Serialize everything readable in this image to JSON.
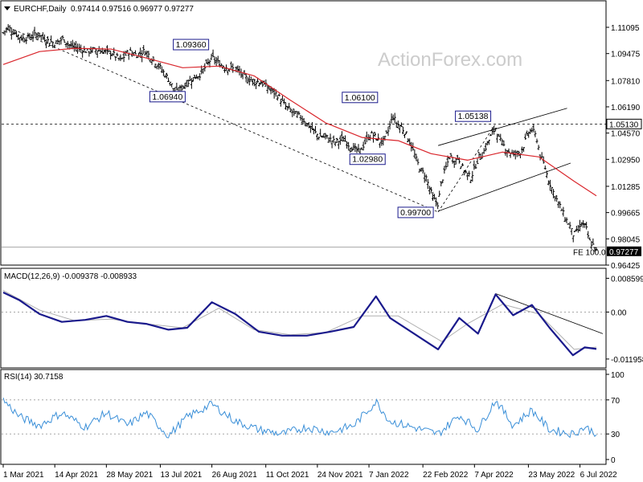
{
  "header": {
    "symbol_icon": "triangle-down-icon",
    "symbol": "EURCHF,Daily",
    "ohlc": "0.97414 0.97516 0.96977 0.97277"
  },
  "watermark": "ActionForex.com",
  "chart_data": [
    {
      "type": "line",
      "panel": "price",
      "yticks": [
        "1.11095",
        "1.09475",
        "1.07810",
        "1.06190",
        "1.04570",
        "1.02950",
        "1.01285",
        "0.99665",
        "0.98045",
        "0.96425"
      ],
      "ylim": [
        0.96425,
        1.11095
      ],
      "price_tag": "0.97277",
      "level_tag": "1.05130",
      "level_value": 1.0513,
      "fe_label": "FE 100.0",
      "fe_value": 0.9753,
      "annotations": [
        {
          "text": "1.09360",
          "x": "26 Aug 2021",
          "y": 1.0936
        },
        {
          "text": "1.06940",
          "x": "26 Jul 2021",
          "y": 1.0694
        },
        {
          "text": "1.06100",
          "x": "13 Jan 2022",
          "y": 1.061
        },
        {
          "text": "1.02980",
          "x": "3 Jan 2022",
          "y": 1.0298
        },
        {
          "text": "0.99700",
          "x": "7 Mar 2022",
          "y": 0.997
        },
        {
          "text": "1.05138",
          "x": "25 Apr 2022",
          "y": 1.05138
        }
      ],
      "close_series": [
        [
          "1 Mar 2021",
          1.1075
        ],
        [
          "5 Mar 2021",
          1.111
        ],
        [
          "10 Mar 2021",
          1.108
        ],
        [
          "17 Mar 2021",
          1.104
        ],
        [
          "24 Mar 2021",
          1.105
        ],
        [
          "31 Mar 2021",
          1.107
        ],
        [
          "7 Apr 2021",
          1.103
        ],
        [
          "14 Apr 2021",
          1.101
        ],
        [
          "21 Apr 2021",
          1.104
        ],
        [
          "28 Apr 2021",
          1.099
        ],
        [
          "5 May 2021",
          1.098
        ],
        [
          "12 May 2021",
          1.096
        ],
        [
          "19 May 2021",
          1.097
        ],
        [
          "26 May 2021",
          1.096
        ],
        [
          "2 Jun 2021",
          1.095
        ],
        [
          "9 Jun 2021",
          1.0905
        ],
        [
          "16 Jun 2021",
          1.096
        ],
        [
          "23 Jun 2021",
          1.094
        ],
        [
          "30 Jun 2021",
          1.0965
        ],
        [
          "7 Jul 2021",
          1.091
        ],
        [
          "14 Jul 2021",
          1.085
        ],
        [
          "21 Jul 2021",
          1.078
        ],
        [
          "26 Jul 2021",
          1.0705
        ],
        [
          "2 Aug 2021",
          1.075
        ],
        [
          "9 Aug 2021",
          1.079
        ],
        [
          "16 Aug 2021",
          1.082
        ],
        [
          "23 Aug 2021",
          1.089
        ],
        [
          "26 Aug 2021",
          1.0925
        ],
        [
          "2 Sep 2021",
          1.088
        ],
        [
          "9 Sep 2021",
          1.086
        ],
        [
          "16 Sep 2021",
          1.085
        ],
        [
          "23 Sep 2021",
          1.08
        ],
        [
          "30 Sep 2021",
          1.078
        ],
        [
          "7 Oct 2021",
          1.077
        ],
        [
          "14 Oct 2021",
          1.073
        ],
        [
          "21 Oct 2021",
          1.069
        ],
        [
          "28 Oct 2021",
          1.062
        ],
        [
          "4 Nov 2021",
          1.058
        ],
        [
          "11 Nov 2021",
          1.055
        ],
        [
          "18 Nov 2021",
          1.049
        ],
        [
          "25 Nov 2021",
          1.044
        ],
        [
          "2 Dec 2021",
          1.043
        ],
        [
          "9 Dec 2021",
          1.04
        ],
        [
          "16 Dec 2021",
          1.042
        ],
        [
          "23 Dec 2021",
          1.037
        ],
        [
          "30 Dec 2021",
          1.034
        ],
        [
          "6 Jan 2022",
          1.043
        ],
        [
          "10 Jan 2022",
          1.045
        ],
        [
          "17 Jan 2022",
          1.04
        ],
        [
          "20 Jan 2022",
          1.041
        ],
        [
          "24 Jan 2022",
          1.048
        ],
        [
          "27 Jan 2022",
          1.057
        ],
        [
          "31 Jan 2022",
          1.051
        ],
        [
          "3 Feb 2022",
          1.05
        ],
        [
          "7 Feb 2022",
          1.046
        ],
        [
          "10 Feb 2022",
          1.042
        ],
        [
          "14 Feb 2022",
          1.034
        ],
        [
          "17 Feb 2022",
          1.028
        ],
        [
          "21 Feb 2022",
          1.022
        ],
        [
          "24 Feb 2022",
          1.02
        ],
        [
          "28 Feb 2022",
          1.011
        ],
        [
          "3 Mar 2022",
          1.005
        ],
        [
          "7 Mar 2022",
          1.002
        ],
        [
          "10 Mar 2022",
          1.016
        ],
        [
          "14 Mar 2022",
          1.025
        ],
        [
          "17 Mar 2022",
          1.032
        ],
        [
          "21 Mar 2022",
          1.028
        ],
        [
          "24 Mar 2022",
          1.031
        ],
        [
          "28 Mar 2022",
          1.024
        ],
        [
          "31 Mar 2022",
          1.021
        ],
        [
          "4 Apr 2022",
          1.018
        ],
        [
          "7 Apr 2022",
          1.024
        ],
        [
          "11 Apr 2022",
          1.031
        ],
        [
          "14 Apr 2022",
          1.033
        ],
        [
          "18 Apr 2022",
          1.039
        ],
        [
          "21 Apr 2022",
          1.044
        ],
        [
          "25 Apr 2022",
          1.049
        ],
        [
          "28 Apr 2022",
          1.042
        ],
        [
          "2 May 2022",
          1.038
        ],
        [
          "5 May 2022",
          1.035
        ],
        [
          "9 May 2022",
          1.033
        ],
        [
          "12 May 2022",
          1.033
        ],
        [
          "16 May 2022",
          1.034
        ],
        [
          "19 May 2022",
          1.038
        ],
        [
          "23 May 2022",
          1.046
        ],
        [
          "26 May 2022",
          1.048
        ],
        [
          "30 May 2022",
          1.043
        ],
        [
          "2 Jun 2022",
          1.032
        ],
        [
          "6 Jun 2022",
          1.025
        ],
        [
          "9 Jun 2022",
          1.017
        ],
        [
          "13 Jun 2022",
          1.01
        ],
        [
          "16 Jun 2022",
          1.005
        ],
        [
          "20 Jun 2022",
          0.999
        ],
        [
          "23 Jun 2022",
          0.994
        ],
        [
          "27 Jun 2022",
          0.989
        ],
        [
          "30 Jun 2022",
          0.983
        ],
        [
          "4 Jul 2022",
          0.985
        ],
        [
          "7 Jul 2022",
          0.99
        ],
        [
          "11 Jul 2022",
          0.988
        ],
        [
          "14 Jul 2022",
          0.979
        ],
        [
          "18 Jul 2022",
          0.976
        ],
        [
          "20 Jul 2022",
          0.9728
        ]
      ],
      "ma_series": [
        [
          "1 Mar 2021",
          1.088
        ],
        [
          "1 Apr 2021",
          1.096
        ],
        [
          "1 May 2021",
          1.098
        ],
        [
          "1 Jun 2021",
          1.0975
        ],
        [
          "1 Jul 2021",
          1.092
        ],
        [
          "1 Aug 2021",
          1.086
        ],
        [
          "1 Sep 2021",
          1.087
        ],
        [
          "1 Oct 2021",
          1.081
        ],
        [
          "1 Nov 2021",
          1.066
        ],
        [
          "1 Dec 2021",
          1.052
        ],
        [
          "1 Jan 2022",
          1.043
        ],
        [
          "1 Feb 2022",
          1.041
        ],
        [
          "1 Mar 2022",
          1.033
        ],
        [
          "1 Apr 2022",
          1.029
        ],
        [
          "1 May 2022",
          1.034
        ],
        [
          "1 Jun 2022",
          1.031
        ],
        [
          "1 Jul 2022",
          1.016
        ],
        [
          "20 Jul 2022",
          1.007
        ]
      ]
    },
    {
      "type": "line",
      "panel": "macd",
      "title": "MACD(12,26,9) -0.009378 -0.008933",
      "yticks": [
        "0.008599",
        "0.00",
        "-0.011958"
      ],
      "ylim": [
        -0.013,
        0.0095
      ],
      "macd_series": [
        [
          "1 Mar 2021",
          0.005
        ],
        [
          "15 Mar 2021",
          0.003
        ],
        [
          "1 Apr 2021",
          -0.0005
        ],
        [
          "20 Apr 2021",
          -0.0025
        ],
        [
          "10 May 2021",
          -0.002
        ],
        [
          "28 May 2021",
          -0.001
        ],
        [
          "15 Jun 2021",
          -0.0025
        ],
        [
          "1 Jul 2021",
          -0.003
        ],
        [
          "20 Jul 2021",
          -0.0045
        ],
        [
          "5 Aug 2021",
          -0.004
        ],
        [
          "26 Aug 2021",
          0.0025
        ],
        [
          "15 Sep 2021",
          -0.0005
        ],
        [
          "5 Oct 2021",
          -0.005
        ],
        [
          "25 Oct 2021",
          -0.006
        ],
        [
          "15 Nov 2021",
          -0.006
        ],
        [
          "5 Dec 2021",
          -0.005
        ],
        [
          "25 Dec 2021",
          -0.0038
        ],
        [
          "13 Jan 2022",
          0.004
        ],
        [
          "25 Jan 2022",
          -0.0015
        ],
        [
          "7 Mar 2022",
          -0.0095
        ],
        [
          "25 Mar 2022",
          -0.0015
        ],
        [
          "10 Apr 2022",
          -0.0055
        ],
        [
          "25 Apr 2022",
          0.0045
        ],
        [
          "10 May 2022",
          -0.0008
        ],
        [
          "26 May 2022",
          0.0018
        ],
        [
          "10 Jun 2022",
          -0.004
        ],
        [
          "30 Jun 2022",
          -0.011
        ],
        [
          "10 Jul 2022",
          -0.009
        ],
        [
          "20 Jul 2022",
          -0.0094
        ]
      ],
      "signal_series": [
        [
          "1 Mar 2021",
          0.0055
        ],
        [
          "1 Apr 2021",
          0.0005
        ],
        [
          "1 May 2021",
          -0.0022
        ],
        [
          "1 Jun 2021",
          -0.0018
        ],
        [
          "1 Jul 2021",
          -0.003
        ],
        [
          "1 Aug 2021",
          -0.004
        ],
        [
          "1 Sep 2021",
          0.001
        ],
        [
          "1 Oct 2021",
          -0.0045
        ],
        [
          "1 Nov 2021",
          -0.0058
        ],
        [
          "1 Dec 2021",
          -0.0052
        ],
        [
          "1 Jan 2022",
          -0.001
        ],
        [
          "1 Feb 2022",
          -0.001
        ],
        [
          "10 Mar 2022",
          -0.0075
        ],
        [
          "1 Apr 2022",
          -0.003
        ],
        [
          "1 May 2022",
          0.002
        ],
        [
          "1 Jun 2022",
          -0.0005
        ],
        [
          "1 Jul 2022",
          -0.0095
        ],
        [
          "20 Jul 2022",
          -0.0089
        ]
      ]
    },
    {
      "type": "line",
      "panel": "rsi",
      "title": "RSI(14) 30.7158",
      "yticks": [
        "100",
        "70",
        "30",
        "0"
      ],
      "ylim": [
        0,
        100
      ],
      "rsi_series": [
        [
          "1 Mar 2021",
          70
        ],
        [
          "15 Mar 2021",
          50
        ],
        [
          "1 Apr 2021",
          40
        ],
        [
          "20 Apr 2021",
          55
        ],
        [
          "10 May 2021",
          38
        ],
        [
          "28 May 2021",
          55
        ],
        [
          "15 Jun 2021",
          40
        ],
        [
          "1 Jul 2021",
          55
        ],
        [
          "20 Jul 2021",
          28
        ],
        [
          "5 Aug 2021",
          50
        ],
        [
          "26 Aug 2021",
          65
        ],
        [
          "15 Sep 2021",
          45
        ],
        [
          "5 Oct 2021",
          35
        ],
        [
          "25 Oct 2021",
          30
        ],
        [
          "15 Nov 2021",
          38
        ],
        [
          "5 Dec 2021",
          32
        ],
        [
          "25 Dec 2021",
          40
        ],
        [
          "13 Jan 2022",
          68
        ],
        [
          "25 Jan 2022",
          45
        ],
        [
          "7 Mar 2022",
          30
        ],
        [
          "25 Mar 2022",
          52
        ],
        [
          "10 Apr 2022",
          35
        ],
        [
          "25 Apr 2022",
          70
        ],
        [
          "10 May 2022",
          40
        ],
        [
          "26 May 2022",
          58
        ],
        [
          "10 Jun 2022",
          35
        ],
        [
          "30 Jun 2022",
          30
        ],
        [
          "10 Jul 2022",
          38
        ],
        [
          "20 Jul 2022",
          31
        ]
      ]
    }
  ],
  "x_ticks": [
    "1 Mar 2021",
    "14 Apr 2021",
    "28 May 2021",
    "13 Jul 2021",
    "26 Aug 2021",
    "11 Oct 2021",
    "24 Nov 2021",
    "7 Jan 2022",
    "22 Feb 2022",
    "7 Apr 2022",
    "23 May 2022",
    "6 Jul 2022"
  ],
  "colors": {
    "bars": "#000000",
    "ma": "#d9262c",
    "macd": "#1a1a8c",
    "signal": "#b0b0b0",
    "rsi": "#3a8fd8",
    "trend_dash": "#000000",
    "channel": "#000000"
  }
}
